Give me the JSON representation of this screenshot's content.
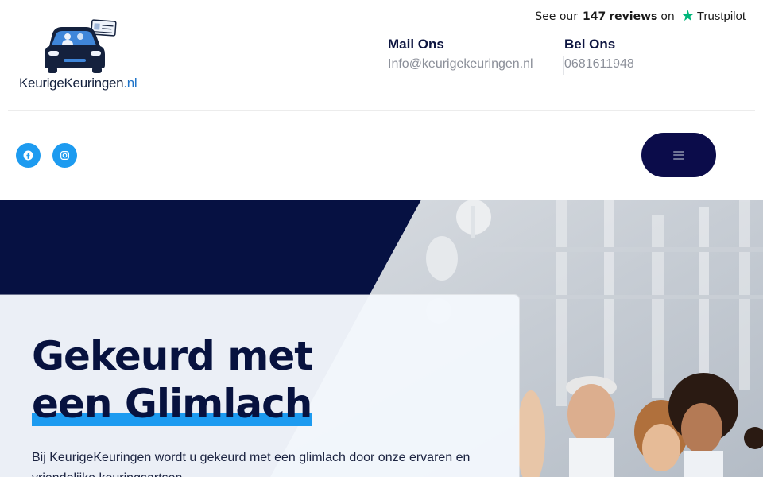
{
  "brand": {
    "name": "KeurigeKeuringen",
    "tld": ".nl"
  },
  "trustpilot": {
    "prefix": "See our",
    "count": "147",
    "reviews_label": "reviews",
    "on": "on",
    "brand": "Trustpilot",
    "star_color": "#00b67a"
  },
  "contact": {
    "mail_title": "Mail Ons",
    "mail_value": "Info@keurigekeuringen.nl",
    "phone_title": "Bel Ons",
    "phone_value": "0681611948"
  },
  "social": {
    "icons": [
      "facebook-icon",
      "instagram-icon"
    ],
    "color": "#1d9bf0"
  },
  "nav": {
    "menu_icon": "hamburger-icon",
    "menu_button_color": "#0b0c4a"
  },
  "hero": {
    "headline_line1": "Gekeurd met",
    "headline_line2": "een Glimlach",
    "intro": "Bij KeurigeKeuringen wordt u gekeurd met een glimlach door onze ervaren en vriendelijke keuringsartsen.",
    "accent": "#1d9bf0",
    "dark": "#061142"
  }
}
